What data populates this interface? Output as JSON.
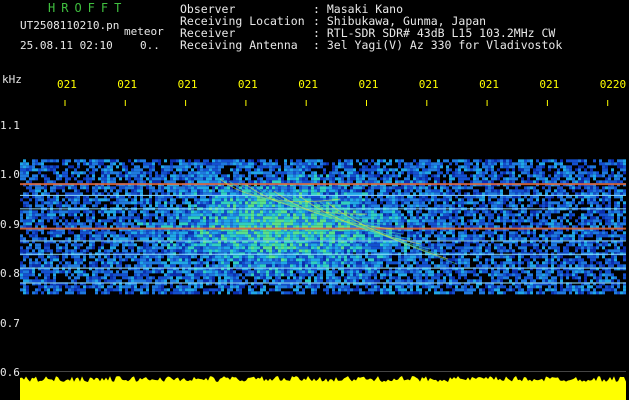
{
  "header": {
    "brand": "HROFFT",
    "filename": "UT2508110210.pn",
    "filename_suffix": "meteor",
    "datetime": "25.08.11 02:10",
    "trailing": "0.."
  },
  "metadata": [
    {
      "label": "Observer",
      "value": ": Masaki Kano"
    },
    {
      "label": "Receiving Location",
      "value": ": Shibukawa, Gunma, Japan"
    },
    {
      "label": "Receiver",
      "value": ": RTL-SDR SDR# 43dB L15 103.2MHz CW"
    },
    {
      "label": "Receiving Antenna",
      "value": ": 3el Yagi(V) Az 330 for Vladivostok"
    }
  ],
  "chart_data": {
    "type": "heatmap",
    "ylabel": "kHz",
    "y_ticks": [
      "1.1",
      "1.0",
      "0.9",
      "0.8",
      "0.7",
      "0.6"
    ],
    "ylim": [
      0.6,
      1.15
    ],
    "time_ticks": [
      "021",
      "021",
      "021",
      "021",
      "021",
      "021",
      "021",
      "021",
      "021",
      "0220"
    ],
    "signal_band_khz": [
      0.76,
      1.03
    ],
    "carrier_lines_khz": [
      0.98,
      0.957,
      0.93,
      0.89,
      0.865,
      0.838,
      0.81,
      0.78
    ],
    "colors": {
      "background": "#000000",
      "ticks": "#ffff00",
      "bottom_bar": "#ffff00",
      "title": "#3fbf3f"
    }
  }
}
